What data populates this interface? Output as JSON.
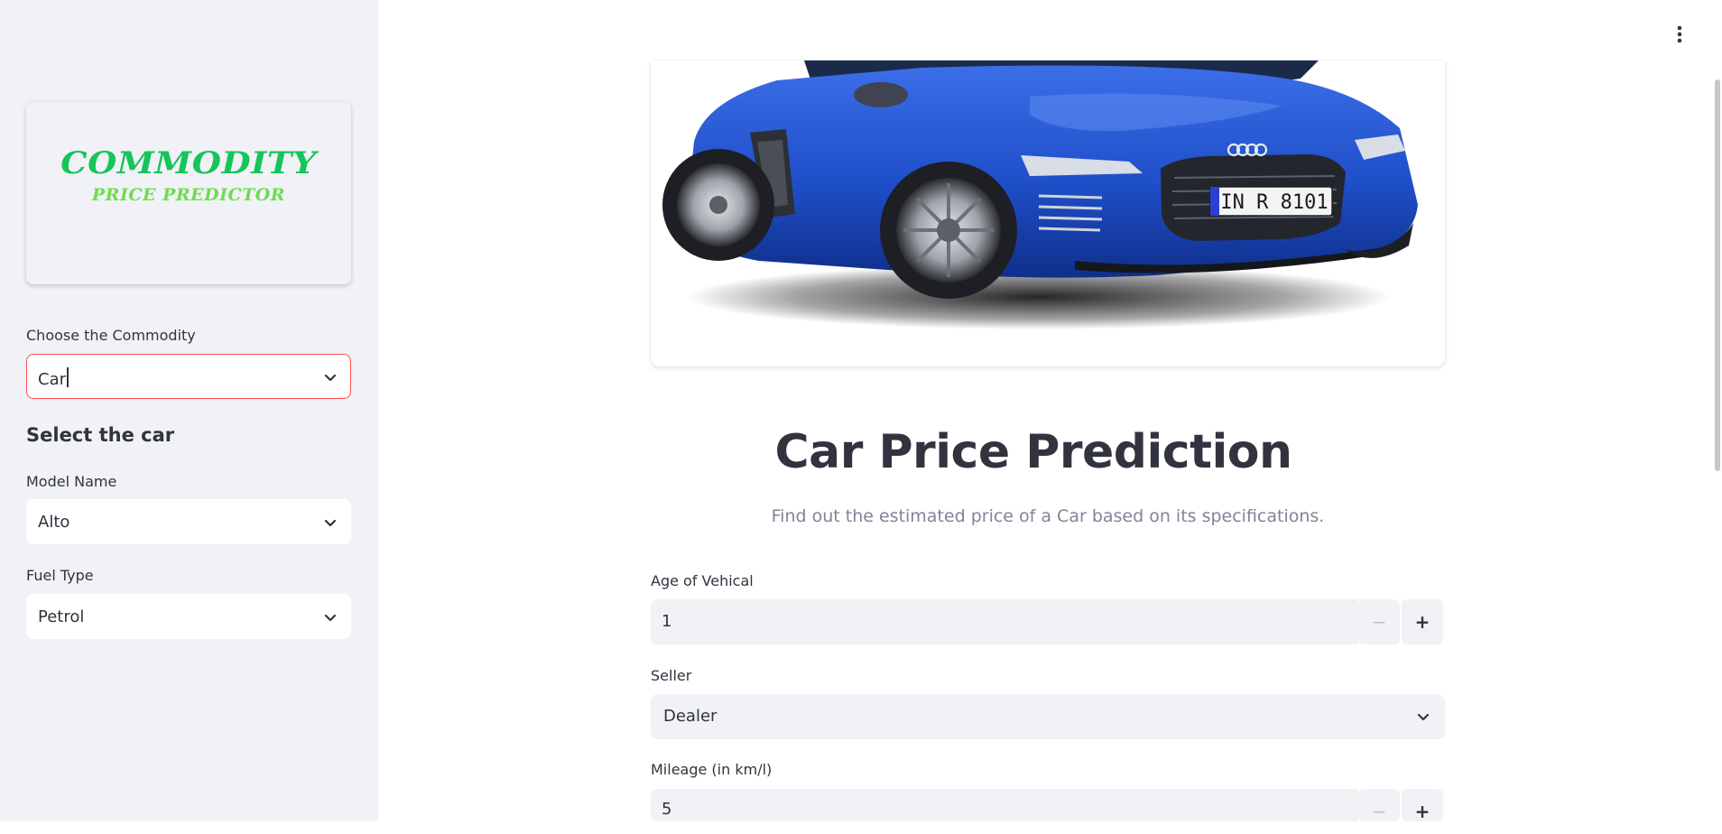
{
  "sidebar": {
    "logo": {
      "line1": "COMMODITY",
      "line2": "PRICE PREDICTOR"
    },
    "commodity": {
      "label": "Choose the Commodity",
      "value": "Car"
    },
    "section_heading": "Select the car",
    "model": {
      "label": "Model Name",
      "value": "Alto"
    },
    "fuel": {
      "label": "Fuel Type",
      "value": "Petrol"
    }
  },
  "main": {
    "hero_image": {
      "plate": "IN R 8101",
      "car_color": "#1f4fc9"
    },
    "title": "Car Price Prediction",
    "subtitle": "Find out the estimated price of a Car based on its specifications.",
    "age": {
      "label": "Age of Vehical",
      "value": "1",
      "minus": "−",
      "plus": "+"
    },
    "seller": {
      "label": "Seller",
      "value": "Dealer"
    },
    "mileage": {
      "label": "Mileage (in km/l)",
      "value": "5",
      "minus": "−",
      "plus": "+"
    }
  },
  "colors": {
    "accent": "#ff4b4b",
    "logo_green": "#16c55a",
    "sidebar_bg": "#f0f2f6"
  },
  "icons": {
    "select_toggle": "chevron-down-icon",
    "menu": "kebab-menu-icon"
  }
}
